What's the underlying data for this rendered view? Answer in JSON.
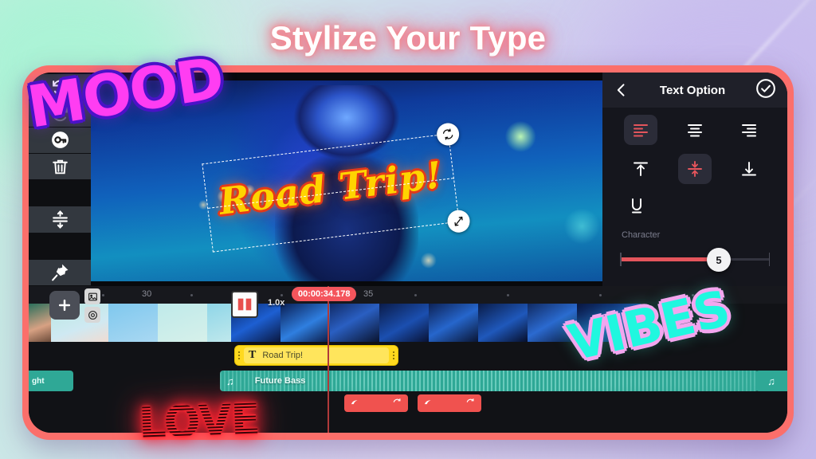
{
  "headline": "Stylize Your Type",
  "stickers": [
    {
      "name": "mood",
      "text": "MOOD"
    },
    {
      "name": "vibes",
      "text": "VIBES"
    },
    {
      "name": "love",
      "text": "LOVE"
    }
  ],
  "colors": {
    "phone_bezel": "#fb6f6b",
    "accent_red": "#e4555c",
    "text_clip_yellow": "#ffd91e",
    "audio_clip_teal": "#2fa896",
    "fx_clip_red": "#f0524f",
    "sticker_mood": "#ff3df2",
    "sticker_vibes": "#20f7df",
    "sticker_love": "#ff2b35"
  },
  "toolbar": {
    "items": [
      {
        "icon": "undo-icon",
        "state": "enabled"
      },
      {
        "icon": "redo-icon",
        "state": "disabled"
      },
      {
        "icon": "key-icon",
        "state": "enabled"
      },
      {
        "icon": "trash-icon",
        "state": "enabled"
      },
      {
        "icon": "split-adjust-icon",
        "state": "enabled"
      },
      {
        "icon": "pin-icon",
        "state": "enabled"
      }
    ]
  },
  "preview": {
    "overlay_text": "Road Trip!",
    "rotate_handle_icon": "rotate-icon",
    "resize_handle_icon": "resize-diagonal-icon"
  },
  "panel": {
    "back_icon": "back-chevron-icon",
    "title": "Text Option",
    "confirm_icon": "check-circle-icon",
    "horizontal_align": [
      {
        "name": "align-left",
        "selected": true
      },
      {
        "name": "align-center",
        "selected": false
      },
      {
        "name": "align-right",
        "selected": false
      }
    ],
    "vertical_align": [
      {
        "name": "align-top",
        "selected": false
      },
      {
        "name": "align-middle",
        "selected": true
      },
      {
        "name": "align-bottom",
        "selected": false
      }
    ],
    "underline": {
      "name": "underline-icon",
      "label": "U",
      "selected": false
    },
    "slider": {
      "label": "Character",
      "value": "5"
    }
  },
  "timeline": {
    "ruler_marks": [
      "30",
      "35"
    ],
    "current_time": "00:00:34.178",
    "speed_label": "1.0x",
    "add_button_icon": "plus-icon",
    "mini_buttons": [
      {
        "icon": "image-icon"
      },
      {
        "icon": "camera-icon"
      }
    ],
    "transition_icon": "transition-icon",
    "clips": {
      "text_clip": {
        "icon": "text-T-icon",
        "label": "Road Trip!"
      },
      "audio_clip": {
        "icon": "music-note-icon",
        "label": "Future Bass"
      },
      "audio_clip_left": {
        "label": "ght"
      },
      "audio_clip_right": {
        "icon": "music-note-icon"
      },
      "fx_clips": [
        {
          "icon": "sound-effect-icon"
        },
        {
          "icon": "sound-effect-icon"
        }
      ]
    }
  }
}
